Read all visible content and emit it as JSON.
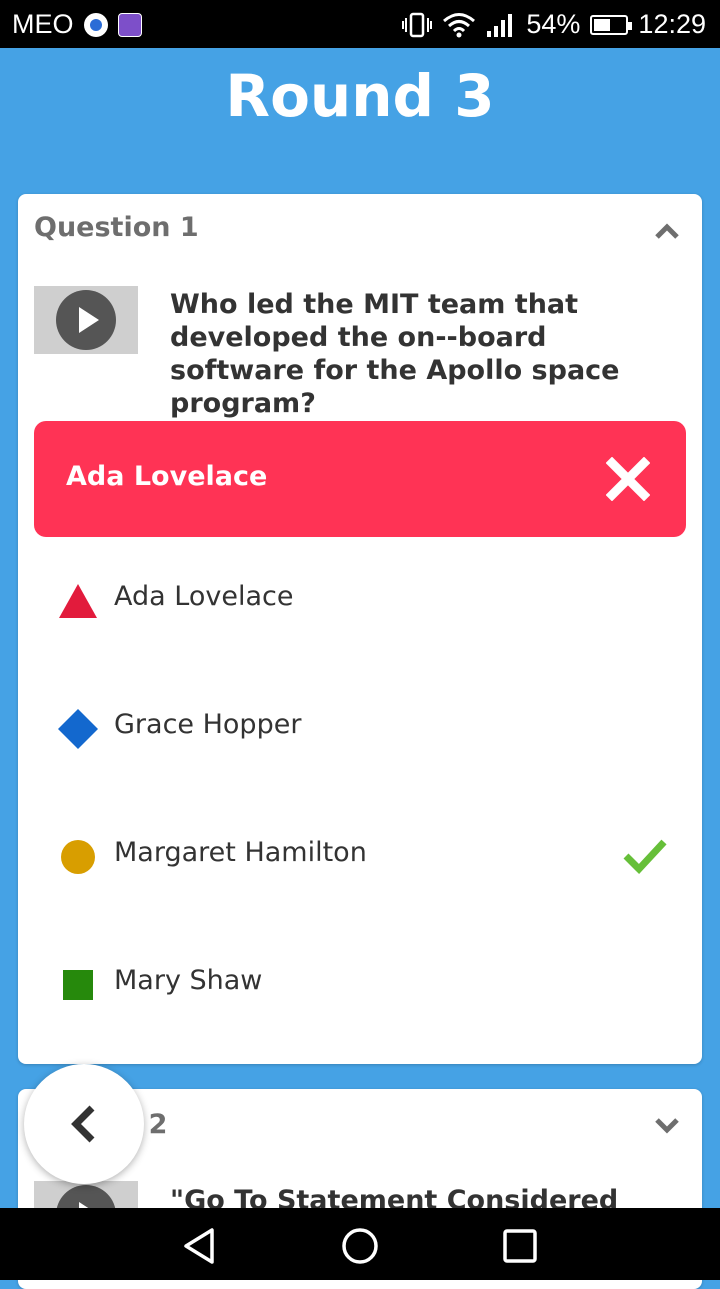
{
  "status_bar": {
    "carrier": "MEO",
    "battery": "54%",
    "battery_level": 0.54,
    "time": "12:29"
  },
  "screen": {
    "title": "Round 3"
  },
  "questions": [
    {
      "label": "Question 1",
      "expanded": true,
      "text": "Who led the MIT team that developed the on--board software for the Apollo space program?",
      "selected_answer": "Ada Lovelace",
      "selected_correct": false,
      "options": [
        {
          "shape": "triangle",
          "color": "#e21b3c",
          "label": "Ada Lovelace",
          "correct": false
        },
        {
          "shape": "diamond",
          "color": "#1368ce",
          "label": "Grace Hopper",
          "correct": false
        },
        {
          "shape": "circle",
          "color": "#d89e00",
          "label": "Margaret Hamilton",
          "correct": true
        },
        {
          "shape": "square",
          "color": "#26890c",
          "label": "Mary Shaw",
          "correct": false
        }
      ]
    },
    {
      "label": "Question 2",
      "label_visible": "n 2",
      "expanded": false,
      "text": "\"Go To Statement Considered"
    }
  ],
  "colors": {
    "background": "#45a2e5",
    "wrong_banner": "#ff3355",
    "check": "#66bf39"
  },
  "icons": {
    "play": "play-icon",
    "wrong": "close-icon",
    "correct": "checkmark-icon",
    "collapse": "chevron-up-icon",
    "expand": "chevron-down-icon",
    "back": "chevron-left-icon"
  }
}
